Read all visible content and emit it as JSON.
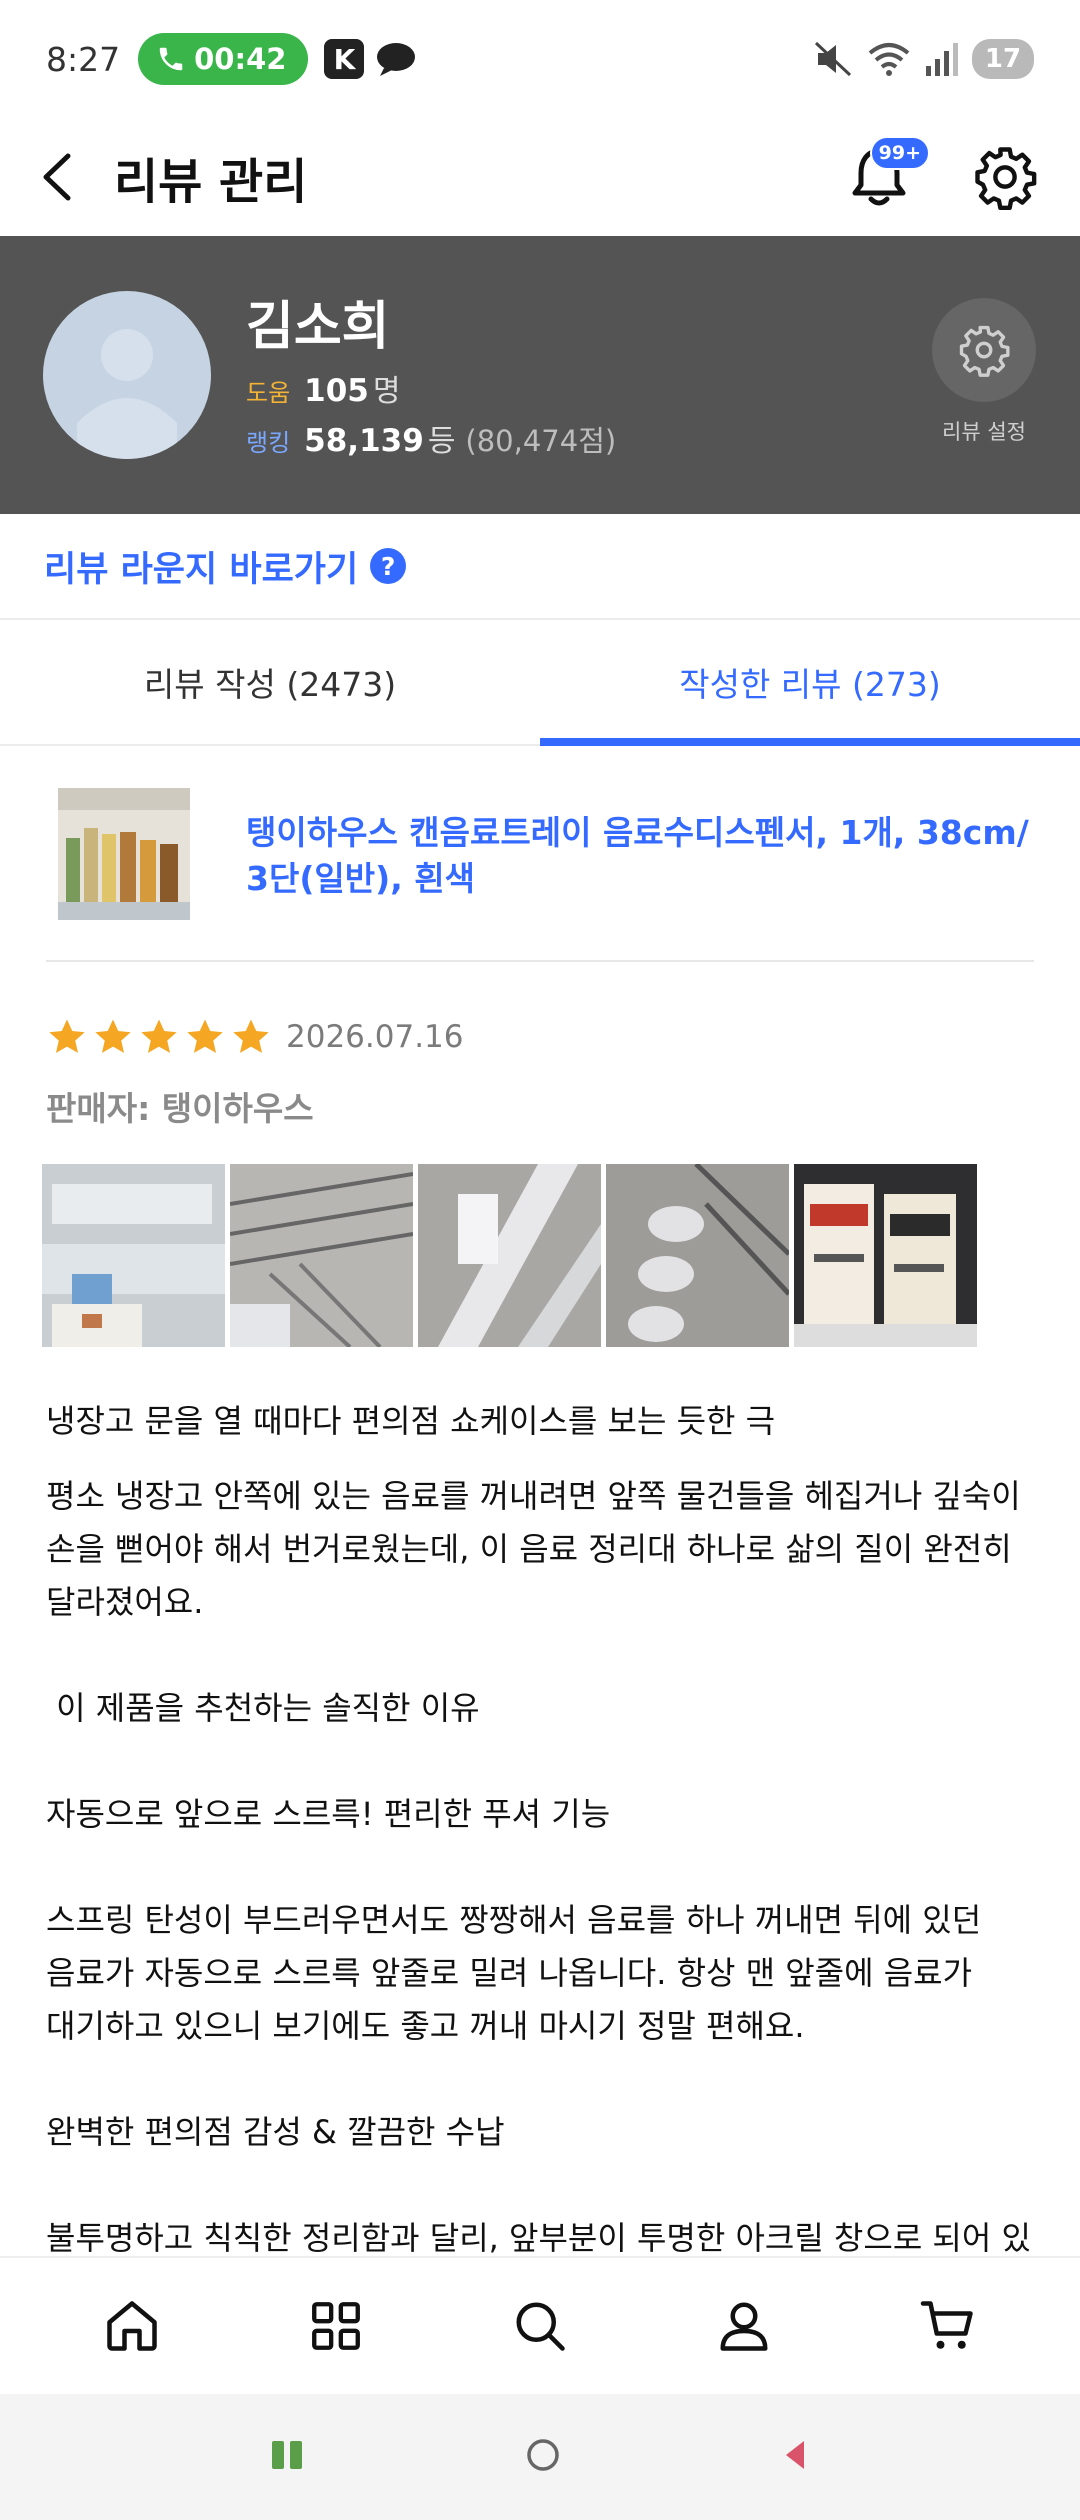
{
  "status_bar": {
    "time": "8:27",
    "call_duration": "00:42",
    "k_badge": "K",
    "battery": "17"
  },
  "header": {
    "title": "리뷰 관리",
    "notification_badge": "99+"
  },
  "profile": {
    "name": "김소희",
    "help_label": "도움",
    "help_count": "105",
    "help_unit": "명",
    "rank_label": "랭킹",
    "rank_value": "58,139",
    "rank_unit": "등",
    "rank_points": "(80,474점)",
    "settings_label": "리뷰 설정"
  },
  "lounge": {
    "link_text": "리뷰 라운지 바로가기",
    "help_icon_text": "?"
  },
  "tabs": [
    {
      "label": "리뷰 작성 (2473)",
      "active": false
    },
    {
      "label": "작성한 리뷰 (273)",
      "active": true
    }
  ],
  "product": {
    "name": "탱이하우스 캔음료트레이 음료수디스펜서, 1개, 38cm/ 3단(일반), 흰색"
  },
  "review": {
    "rating": 5,
    "date": "2026.07.16",
    "seller": "판매자: 탱이하우스",
    "photo_count": 5,
    "title": "냉장고 문을 열 때마다 편의점 쇼케이스를 보는 듯한 극",
    "body": [
      "평소 냉장고 안쪽에 있는 음료를 꺼내려면 앞쪽 물건들을 헤집거나 깊숙이",
      "손을 뻗어야 해서 번거로웠는데, 이 음료 정리대 하나로 삶의 질이 완전히",
      "달라졌어요.",
      "",
      " 이 제품을 추천하는 솔직한 이유",
      "",
      "자동으로 앞으로 스르륵! 편리한 푸셔 기능",
      "",
      "스프링 탄성이 부드러우면서도 짱짱해서 음료를 하나 꺼내면 뒤에 있던",
      "음료가 자동으로 스르륵 앞줄로 밀려 나옵니다. 항상 맨 앞줄에 음료가",
      "대기하고 있으니 보기에도 좋고 꺼내 마시기 정말 편해요.",
      "",
      "완벽한 편의점 감성 & 깔끔한 수납",
      "",
      "불투명하고 칙칙한 정리함과 달리, 앞부분이 투명한 아크릴 창으로 되어 있어"
    ]
  },
  "colors": {
    "accent": "#346aff",
    "profile_bg": "#545454",
    "star": "#f5a623",
    "call_green": "#39b54a"
  },
  "icons": {
    "bottom_nav": [
      "home-icon",
      "grid-icon",
      "search-icon",
      "person-icon",
      "cart-icon"
    ],
    "system_nav": [
      "recent-apps-icon",
      "home-circle-icon",
      "back-triangle-icon"
    ]
  }
}
